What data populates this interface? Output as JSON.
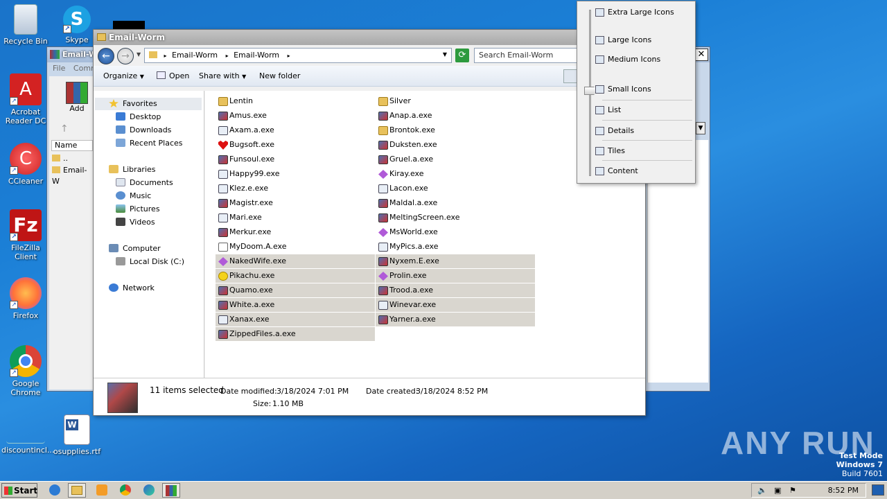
{
  "desktop": {
    "icons": [
      {
        "label": "Recycle Bin"
      },
      {
        "label": "Skype"
      },
      {
        "label": "Acrobat Reader DC"
      },
      {
        "label": "CCleaner"
      },
      {
        "label": "FileZilla Client"
      },
      {
        "label": "Firefox"
      },
      {
        "label": "Google Chrome"
      },
      {
        "label": "discountincl..."
      },
      {
        "label": "osupplies.rtf"
      }
    ]
  },
  "bg_window": {
    "title": "Email-W",
    "menu": [
      "File",
      "Comm"
    ],
    "add_label": "Add",
    "col_name": "Name",
    "rows": [
      "..",
      "Email-W"
    ]
  },
  "explorer": {
    "title": "Email-Worm",
    "address": [
      "Email-Worm",
      "Email-Worm"
    ],
    "search_placeholder": "Search Email-Worm",
    "toolbar": {
      "organize": "Organize",
      "open": "Open",
      "share": "Share with",
      "new_folder": "New folder"
    },
    "nav": {
      "favorites": "Favorites",
      "fav_items": [
        "Desktop",
        "Downloads",
        "Recent Places"
      ],
      "libraries": "Libraries",
      "lib_items": [
        "Documents",
        "Music",
        "Pictures",
        "Videos"
      ],
      "computer": "Computer",
      "computer_items": [
        "Local Disk (C:)"
      ],
      "network": "Network"
    },
    "files_col1": [
      {
        "name": "Lentin",
        "icon": "folder-icon",
        "selected": false
      },
      {
        "name": "Amus.exe",
        "icon": "exe-icon",
        "selected": false
      },
      {
        "name": "Axam.a.exe",
        "icon": "window-icon",
        "selected": false
      },
      {
        "name": "Bugsoft.exe",
        "icon": "heart-icon",
        "selected": false
      },
      {
        "name": "Funsoul.exe",
        "icon": "exe-icon",
        "selected": false
      },
      {
        "name": "Happy99.exe",
        "icon": "window-icon",
        "selected": false
      },
      {
        "name": "Klez.e.exe",
        "icon": "window-icon",
        "selected": false
      },
      {
        "name": "Magistr.exe",
        "icon": "exe-icon",
        "selected": false
      },
      {
        "name": "Mari.exe",
        "icon": "window-icon",
        "selected": false
      },
      {
        "name": "Merkur.exe",
        "icon": "exe-icon",
        "selected": false
      },
      {
        "name": "MyDoom.A.exe",
        "icon": "document-icon",
        "selected": false
      },
      {
        "name": "NakedWife.exe",
        "icon": "diamond-icon",
        "selected": true
      },
      {
        "name": "Pikachu.exe",
        "icon": "smiley-icon",
        "selected": true
      },
      {
        "name": "Quamo.exe",
        "icon": "exe-icon",
        "selected": true
      },
      {
        "name": "White.a.exe",
        "icon": "exe-icon",
        "selected": true
      },
      {
        "name": "Xanax.exe",
        "icon": "window-icon",
        "selected": true
      },
      {
        "name": "ZippedFiles.a.exe",
        "icon": "exe-icon",
        "selected": true
      }
    ],
    "files_col2": [
      {
        "name": "Silver",
        "icon": "folder-icon",
        "selected": false
      },
      {
        "name": "Anap.a.exe",
        "icon": "exe-icon",
        "selected": false
      },
      {
        "name": "Brontok.exe",
        "icon": "folder-icon",
        "selected": false
      },
      {
        "name": "Duksten.exe",
        "icon": "exe-icon",
        "selected": false
      },
      {
        "name": "Gruel.a.exe",
        "icon": "exe-icon",
        "selected": false
      },
      {
        "name": "Kiray.exe",
        "icon": "diamond-icon",
        "selected": false
      },
      {
        "name": "Lacon.exe",
        "icon": "window-icon",
        "selected": false
      },
      {
        "name": "Maldal.a.exe",
        "icon": "exe-icon",
        "selected": false
      },
      {
        "name": "MeltingScreen.exe",
        "icon": "exe-icon",
        "selected": false
      },
      {
        "name": "MsWorld.exe",
        "icon": "diamond-icon",
        "selected": false
      },
      {
        "name": "MyPics.a.exe",
        "icon": "window-icon",
        "selected": false
      },
      {
        "name": "Nyxem.E.exe",
        "icon": "exe-icon",
        "selected": true
      },
      {
        "name": "Prolin.exe",
        "icon": "diamond-icon",
        "selected": true
      },
      {
        "name": "Trood.a.exe",
        "icon": "exe-icon",
        "selected": true
      },
      {
        "name": "Winevar.exe",
        "icon": "window-icon",
        "selected": true
      },
      {
        "name": "Yarner.a.exe",
        "icon": "exe-icon",
        "selected": true
      }
    ],
    "details": {
      "count": "11 items selected",
      "modified_label": "Date modified:",
      "modified": "3/18/2024 7:01 PM",
      "created_label": "Date created:",
      "created": "3/18/2024 8:52 PM",
      "size_label": "Size:",
      "size": "1.10 MB"
    }
  },
  "view_menu": {
    "items": [
      "Extra Large Icons",
      "Large Icons",
      "Medium Icons",
      "Small Icons",
      "List",
      "Details",
      "Tiles",
      "Content"
    ],
    "current": "Small Icons"
  },
  "taskbar": {
    "start": "Start",
    "clock": "8:52 PM"
  },
  "watermark": {
    "line1": "Test Mode",
    "line2": "Windows 7",
    "line3": "Build 7601",
    "brand": "ANY RUN"
  },
  "colors": {
    "selection": "#d9d6cf",
    "desktop": "#1b7fd6"
  }
}
